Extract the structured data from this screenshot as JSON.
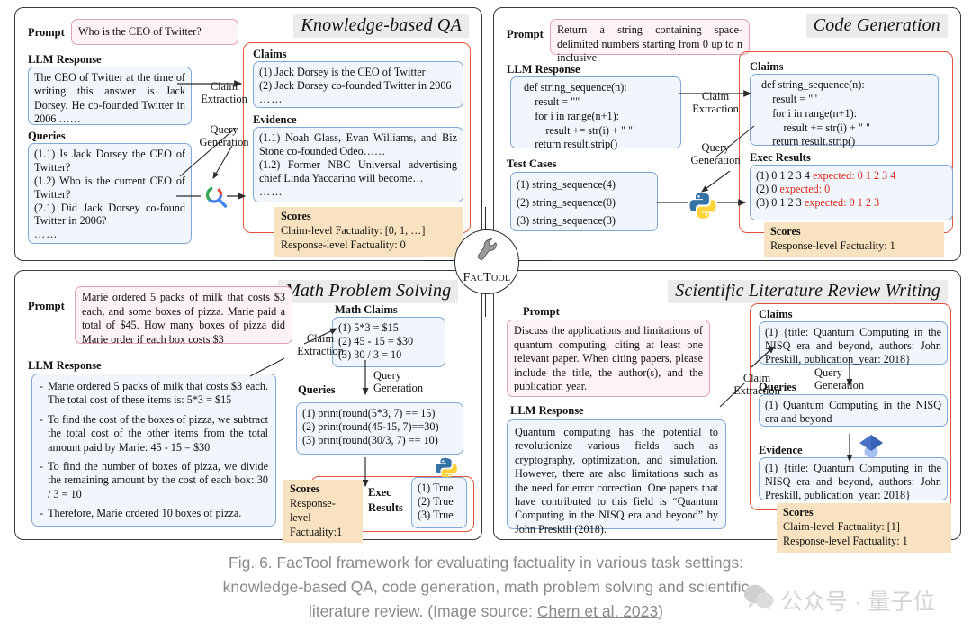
{
  "figure": {
    "caption_line1": "Fig. 6. FacTool framework for evaluating factuality in various task settings:",
    "caption_line2": "knowledge-based QA, code generation, math problem solving and scientific",
    "caption_line3_pre": "literature review. (Image source: ",
    "caption_source": "Chern et al. 2023",
    "caption_line3_post": ")",
    "center_logo_label": "FacTool",
    "center_logo_icon": "wrench-icon",
    "watermark_text": "公众号 · 量子位",
    "watermark_icon": "wechat-icon"
  },
  "colors": {
    "panel_border": "#3a3a3a",
    "blue_box_border": "#7fa8d4",
    "blue_box_fill": "#f0f6fc",
    "pink_box_border": "#e39fb4",
    "pink_box_fill": "#fdf2f5",
    "scores_fill": "#f8e2c0",
    "red_group_border": "#e0533a",
    "red_text": "#e02a1a",
    "title_chip_bg": "#ebebeb"
  },
  "labels": {
    "prompt": "Prompt",
    "llm_response": "LLM Response",
    "queries": "Queries",
    "claims": "Claims",
    "evidence": "Evidence",
    "scores": "Scores",
    "test_cases": "Test Cases",
    "exec_results": "Exec Results",
    "math_claims": "Math Claims",
    "claim_extraction_l1": "Claim",
    "claim_extraction_l2": "Extraction",
    "query_generation_l1": "Query",
    "query_generation_l2": "Generation"
  },
  "panels": {
    "kbqa": {
      "title": "Knowledge-based QA",
      "prompt": "Who is the CEO of Twitter?",
      "llm_response": "The CEO of Twitter at the time of writing this answer is Jack Dorsey. He co-founded Twitter in 2006 ……",
      "queries": [
        "(1.1) Is Jack Dorsey the CEO of Twitter?",
        "(1.2) Who is the current CEO of Twitter?",
        "(2.1) Did Jack Dorsey co-found Twitter in 2006?",
        "……"
      ],
      "claims": [
        "(1) Jack Dorsey is the CEO of Twitter",
        "(2) Jack Dorsey co-founded Twitter in 2006",
        "……"
      ],
      "evidence": [
        "(1.1) Noah Glass, Evan Williams, and Biz Stone co-founded Odeo……",
        "(1.2) Former NBC Universal advertising chief Linda Yaccarino will become…",
        "……"
      ],
      "scores": {
        "claim_level": "Claim-level Factuality: [0, 1, …]",
        "response_level": "Response-level Factuality: 0"
      },
      "tool_icon": "google-search-icon"
    },
    "code": {
      "title": "Code Generation",
      "prompt": "Return a string containing space-delimited numbers starting from 0 up to n inclusive.",
      "llm_response_code": "def string_sequence(n):\n    result = \"\"\n    for i in range(n+1):\n        result += str(i) + \" \"\n    return result.strip()",
      "test_cases": [
        "(1) string_sequence(4)",
        "(2) string_sequence(0)",
        "(3) string_sequence(3)"
      ],
      "claims_code": "def string_sequence(n):\n    result = \"\"\n    for i in range(n+1):\n        result += str(i) + \" \"\n    return result.strip()",
      "exec_results": [
        {
          "actual": "(1) 0 1 2 3 4 ",
          "expected": "expected: 0 1 2 3 4"
        },
        {
          "actual": "(2) 0 ",
          "expected": "expected: 0"
        },
        {
          "actual": "(3) 0 1 2 3 ",
          "expected": "expected: 0 1 2 3"
        }
      ],
      "scores": {
        "response_level": "Response-level Factuality: 1"
      },
      "tool_icon": "python-icon"
    },
    "math": {
      "title": "Math Problem Solving",
      "prompt": "Marie ordered 5 packs of milk that costs $3 each, and some boxes of pizza. Marie paid a total of $45. How many boxes of pizza did Marie order if each box costs $3",
      "llm_response_bullets": [
        "Marie ordered 5 packs of milk that costs $3 each. The total cost of these items is: 5*3 = $15",
        "To find the cost of the boxes of pizza, we subtract the total cost of the other items from the total amount paid by Marie: 45 - 15 = $30",
        "To find the number of boxes of pizza, we divide the remaining amount by the cost of each box: 30 / 3 = 10",
        "Therefore, Marie ordered 10 boxes of pizza."
      ],
      "math_claims": [
        "(1) 5*3 = $15",
        "(2) 45 - 15 = $30",
        "(3) 30 / 3 = 10"
      ],
      "queries": [
        "(1) print(round(5*3, 7) == 15)",
        "(2) print(round(45-15, 7)==30)",
        "(3) print(round(30/3, 7) == 10)"
      ],
      "exec_results": [
        "(1) True",
        "(2) True",
        "(3) True"
      ],
      "exec_label_l1": "Exec",
      "exec_label_l2": "Results",
      "scores": {
        "line1": "Response-level",
        "line2": "Factuality:1"
      },
      "tool_icon": "python-icon"
    },
    "sci": {
      "title": "Scientific Literature Review Writing",
      "prompt": "Discuss the applications and limitations of quantum computing, citing at least one relevant paper. When citing papers, please include the title, the author(s), and the publication year.",
      "llm_response": "Quantum computing has the potential to revolutionize various fields such as cryptography, optimization, and simulation. However, there are also limitations such as the need for error correction. One papers that have contributed to this field is “Quantum Computing in the NISQ era and beyond” by John Preskill (2018).",
      "claims": [
        "(1) {title: Quantum Computing in the NISQ era and beyond, authors: John Preskill, publication_year: 2018}"
      ],
      "queries": [
        "(1) Quantum Computing in the NISQ era and beyond"
      ],
      "evidence": [
        "(1) {title: Quantum Computing in the NISQ era and beyond, authors: John Preskill, publication_year: 2018}"
      ],
      "scores": {
        "claim_level": "Claim-level Factuality: [1]",
        "response_level": "Response-level Factuality: 1"
      },
      "tool_icon": "google-scholar-icon"
    }
  }
}
